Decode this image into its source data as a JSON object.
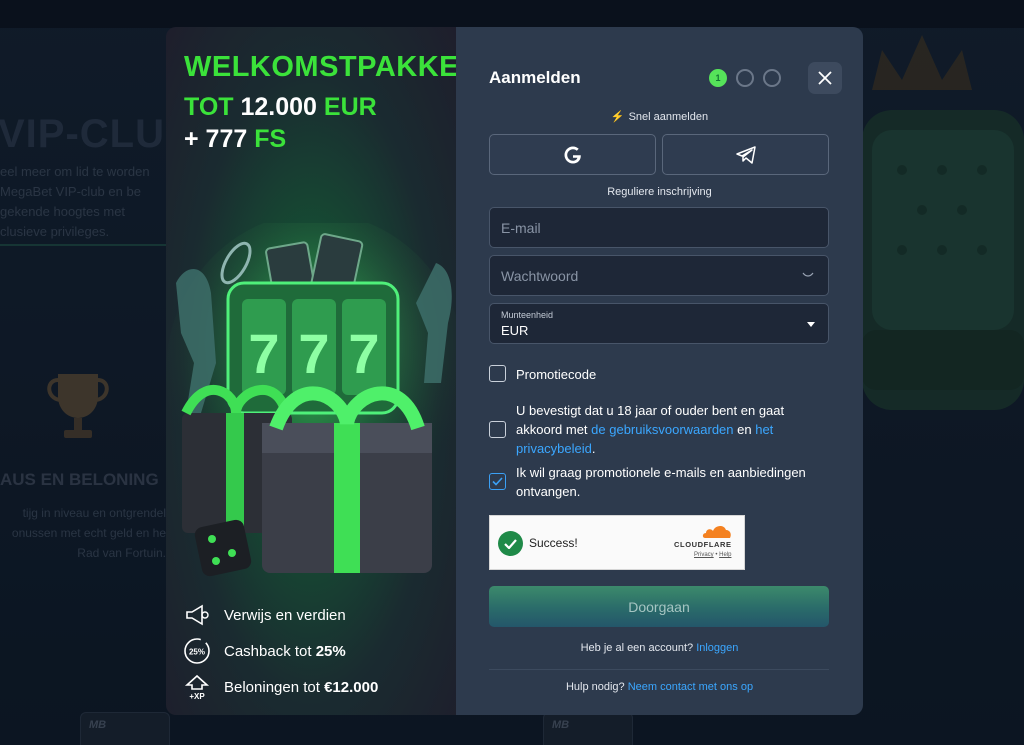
{
  "background": {
    "vip_title": "VIP-CLUB",
    "vip_text": "eel meer om lid te worden MegaBet VIP-club en be gekende hoogtes met clusieve privileges.",
    "status_title": "AUS EN BELONING",
    "status_text": "tijg in niveau en ontgrendel onussen met echt geld en he Rad van Fortuin.",
    "card_logo": "MB"
  },
  "promo": {
    "title": "WELKOMSTPAKKET",
    "line2_prefix": "TOT",
    "line2_amount": "12.000",
    "line2_currency": "EUR",
    "line3_prefix": "+ 777",
    "line3_unit": "FS",
    "perks": [
      {
        "icon": "megaphone-icon",
        "text": "Verwijs en verdien",
        "bold": ""
      },
      {
        "icon": "cashback-percent-icon",
        "icon_text": "25%",
        "text": "Cashback tot ",
        "bold": "25%"
      },
      {
        "icon": "xp-rewards-icon",
        "icon_text": "+XP",
        "text": "Beloningen tot ",
        "bold": "€12.000"
      }
    ]
  },
  "form": {
    "title": "Aanmelden",
    "steps": [
      {
        "label": "1",
        "active": true
      },
      {
        "label": "",
        "active": false
      },
      {
        "label": "",
        "active": false
      }
    ],
    "quick_signup_label": "Snel aanmelden",
    "regular_signup_label": "Reguliere inschrijving",
    "email_placeholder": "E-mail",
    "password_placeholder": "Wachtwoord",
    "currency_label": "Munteenheid",
    "currency_value": "EUR",
    "promo_code_label": "Promotiecode",
    "age_confirm_text": "U bevestigt dat u 18 jaar of ouder bent en gaat akkoord met ",
    "terms_link": "de gebruiksvoorwaarden",
    "and_text": " en ",
    "privacy_link": "het privacybeleid",
    "age_confirm_end": ".",
    "marketing_text": "Ik wil graag promotionele e-mails en aanbiedingen ontvangen.",
    "marketing_checked": true,
    "captcha": {
      "status": "Success!",
      "brand": "CLOUDFLARE",
      "privacy": "Privacy",
      "separator": " • ",
      "help": "Help"
    },
    "continue_label": "Doorgaan",
    "have_account_text": "Heb je al een account?",
    "login_link": "Inloggen",
    "help_text": "Hulp nodig?",
    "contact_link": "Neem contact met ons op"
  },
  "colors": {
    "accent_green": "#3be23a",
    "link_blue": "#3ba7ff",
    "form_bg": "#2d3a4d"
  }
}
